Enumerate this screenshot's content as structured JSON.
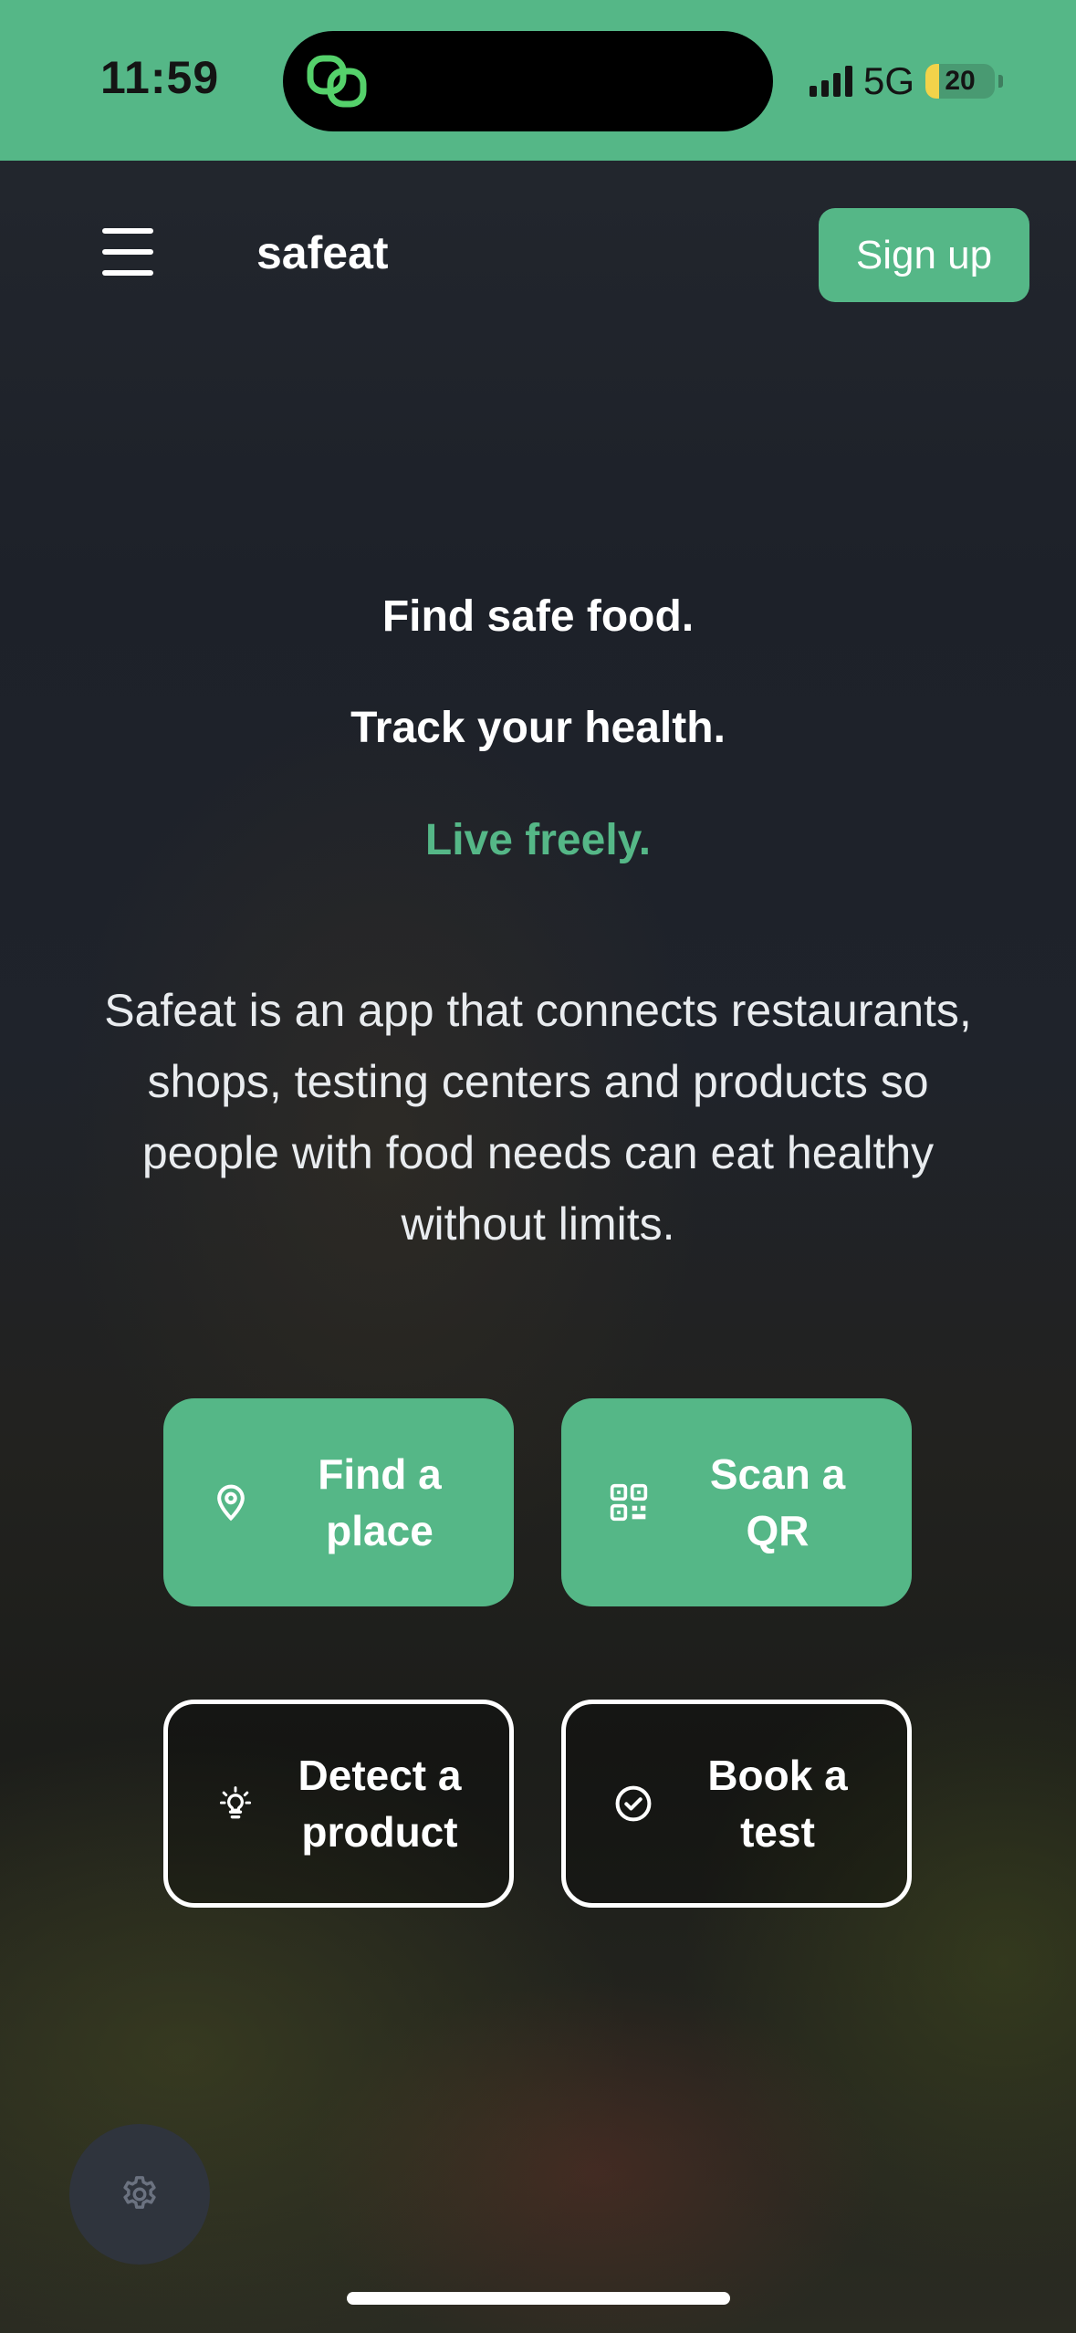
{
  "status_bar": {
    "time": "11:59",
    "network": "5G",
    "battery_level": "20",
    "battery_fraction": 0.2,
    "background_color": "#55b787",
    "island_icon": "link-rings-icon"
  },
  "navbar": {
    "menu_icon": "hamburger-menu-icon",
    "brand": "safeat",
    "signup_label": "Sign up"
  },
  "hero": {
    "line1": "Find safe food.",
    "line2": "Track your health.",
    "line3": "Live freely.",
    "accent_color": "#55b787",
    "description": "Safeat is an app that connects restaurants, shops, testing centers and products so people with food needs can eat healthy without limits."
  },
  "actions": [
    {
      "label": "Find a\nplace",
      "icon": "map-pin-icon",
      "style": "filled"
    },
    {
      "label": "Scan a\nQR",
      "icon": "qr-code-icon",
      "style": "filled"
    },
    {
      "label": "Detect a\nproduct",
      "icon": "lightbulb-icon",
      "style": "outline"
    },
    {
      "label": "Book a\ntest",
      "icon": "check-circle-icon",
      "style": "outline"
    }
  ],
  "footer": {
    "settings_icon": "gear-icon"
  }
}
